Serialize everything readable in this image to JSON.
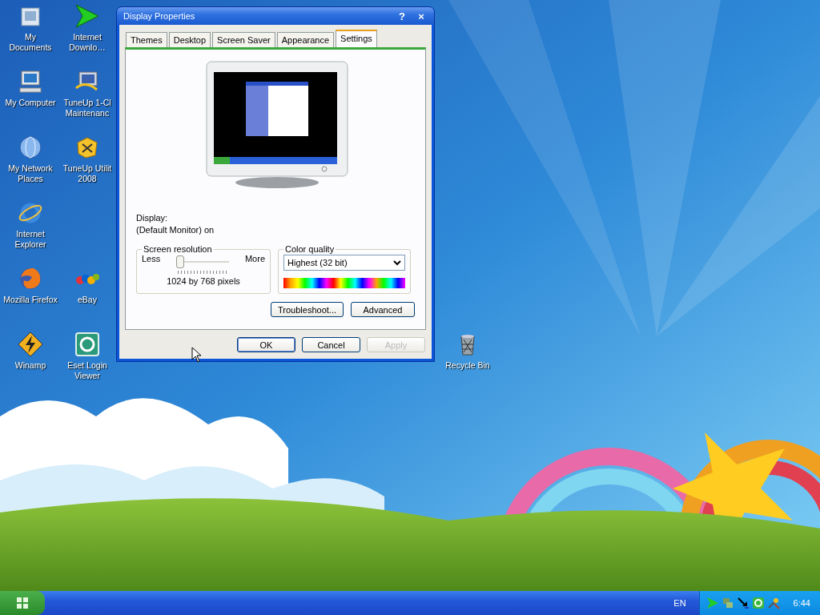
{
  "desktop_icons": [
    {
      "label": "My Documents"
    },
    {
      "label": "Internet Downlo…"
    },
    {
      "label": "My Computer"
    },
    {
      "label": "TuneUp 1-Cl Maintenanc"
    },
    {
      "label": "My Network Places"
    },
    {
      "label": "TuneUp Utilit 2008"
    },
    {
      "label": "Internet Explorer"
    },
    {
      "label": "Mozilla Firefox"
    },
    {
      "label": "eBay"
    },
    {
      "label": "Winamp"
    },
    {
      "label": "Eset Login Viewer"
    },
    {
      "label": "Recycle Bin"
    }
  ],
  "window": {
    "title": "Display Properties",
    "help_button": "?",
    "close_button": "×",
    "tabs": [
      {
        "label": "Themes",
        "selected": false
      },
      {
        "label": "Desktop",
        "selected": false
      },
      {
        "label": "Screen Saver",
        "selected": false
      },
      {
        "label": "Appearance",
        "selected": false
      },
      {
        "label": "Settings",
        "selected": true
      }
    ],
    "display_label": "Display:",
    "display_value": "(Default Monitor) on",
    "resolution": {
      "title": "Screen resolution",
      "less": "Less",
      "more": "More",
      "level": 0,
      "reading": "1024 by 768 pixels"
    },
    "color_quality": {
      "title": "Color quality",
      "value": "Highest (32 bit)"
    },
    "buttons": [
      {
        "label": "Troubleshoot..."
      },
      {
        "label": "Advanced"
      }
    ],
    "dialog_buttons": [
      {
        "label": "OK",
        "disabled": false
      },
      {
        "label": "Cancel",
        "disabled": false
      },
      {
        "label": "Apply",
        "disabled": true
      }
    ]
  },
  "taskbar": {
    "language": "EN",
    "clock": "6:44"
  }
}
